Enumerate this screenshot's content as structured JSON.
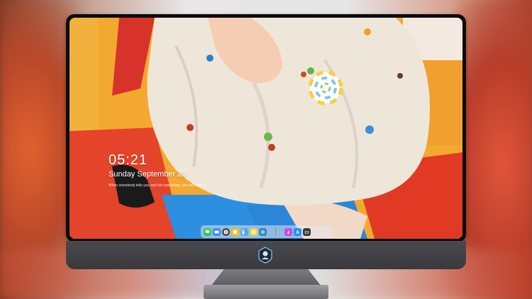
{
  "lockscreen": {
    "time": "05:21",
    "date": "Sunday September 28",
    "quote": "When somebody tells you can't do something, you tell them to ..."
  },
  "dock": {
    "items": [
      {
        "icon": "messages-icon",
        "color": "#34c759"
      },
      {
        "icon": "files-icon",
        "color": "#3a8bf5"
      },
      {
        "icon": "compass-icon",
        "color": "#4a4a4a"
      },
      {
        "icon": "notes-icon",
        "color": "#f5c400"
      },
      {
        "icon": "finder-icon",
        "color": "#5aa9e6"
      },
      {
        "icon": "stickies-icon",
        "color": "#f6d24a"
      },
      {
        "icon": "settings-icon",
        "color": "#2f86d8"
      },
      {
        "icon": "music-icon",
        "color": "#c94be0"
      },
      {
        "icon": "appstore-icon",
        "color": "#1e90ff"
      },
      {
        "icon": "camera-icon",
        "color": "#3b3b3b"
      }
    ]
  },
  "colors": {
    "bezel": "#0b0b0d",
    "chin": "#3f3f43"
  }
}
